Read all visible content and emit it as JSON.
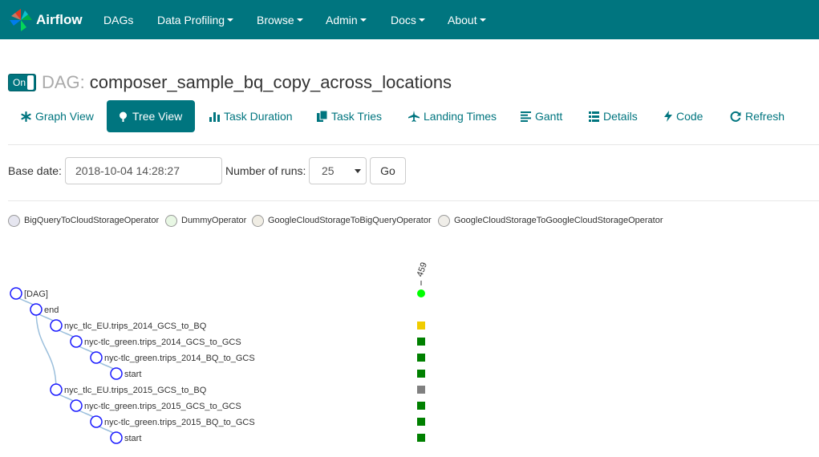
{
  "navbar": {
    "brand": "Airflow",
    "items": [
      {
        "label": "DAGs",
        "dropdown": false
      },
      {
        "label": "Data Profiling",
        "dropdown": true
      },
      {
        "label": "Browse",
        "dropdown": true
      },
      {
        "label": "Admin",
        "dropdown": true
      },
      {
        "label": "Docs",
        "dropdown": true
      },
      {
        "label": "About",
        "dropdown": true
      }
    ],
    "color": "#00757f"
  },
  "title": {
    "toggle_label": "On",
    "prefix": "DAG:",
    "dag_id": "composer_sample_bq_copy_across_locations"
  },
  "tabs": [
    {
      "label": "Graph View",
      "icon": "asterisk-icon",
      "active": false
    },
    {
      "label": "Tree View",
      "icon": "tree-icon",
      "active": true
    },
    {
      "label": "Task Duration",
      "icon": "bar-chart-icon",
      "active": false
    },
    {
      "label": "Task Tries",
      "icon": "duplicate-icon",
      "active": false
    },
    {
      "label": "Landing Times",
      "icon": "plane-icon",
      "active": false
    },
    {
      "label": "Gantt",
      "icon": "align-left-icon",
      "active": false
    },
    {
      "label": "Details",
      "icon": "list-icon",
      "active": false
    },
    {
      "label": "Code",
      "icon": "flash-icon",
      "active": false
    },
    {
      "label": "Refresh",
      "icon": "refresh-icon",
      "active": false
    }
  ],
  "form": {
    "base_date_label": "Base date:",
    "base_date_value": "2018-10-04 14:28:27",
    "num_runs_label": "Number of runs:",
    "num_runs_value": "25",
    "go_label": "Go"
  },
  "legend": [
    {
      "label": "BigQueryToCloudStorageOperator",
      "color": "#e6e6f0"
    },
    {
      "label": "DummyOperator",
      "color": "#e8f7e4"
    },
    {
      "label": "GoogleCloudStorageToBigQueryOperator",
      "color": "#f0ede4"
    },
    {
      "label": "GoogleCloudStorageToGoogleCloudStorageOperator",
      "color": "#f0eee9"
    }
  ],
  "tree": {
    "run_label": "459",
    "nodes": [
      {
        "label": "[DAG]",
        "depth": 0,
        "status": "success",
        "status_color": "#00ff00",
        "status_shape": "circle"
      },
      {
        "label": "end",
        "depth": 1,
        "status": "none",
        "status_color": "#ffffff",
        "status_shape": "square"
      },
      {
        "label": "nyc_tlc_EU.trips_2014_GCS_to_BQ",
        "depth": 2,
        "status": "upstream_failed",
        "status_color": "#f0cc00",
        "status_shape": "square"
      },
      {
        "label": "nyc-tlc_green.trips_2014_GCS_to_GCS",
        "depth": 3,
        "status": "success",
        "status_color": "#008000",
        "status_shape": "square"
      },
      {
        "label": "nyc-tlc_green.trips_2014_BQ_to_GCS",
        "depth": 4,
        "status": "success",
        "status_color": "#008000",
        "status_shape": "square"
      },
      {
        "label": "start",
        "depth": 5,
        "status": "success",
        "status_color": "#008000",
        "status_shape": "square"
      },
      {
        "label": "nyc_tlc_EU.trips_2015_GCS_to_BQ",
        "depth": 2,
        "status": "failed",
        "status_color": "#808080",
        "status_shape": "square"
      },
      {
        "label": "nyc-tlc_green.trips_2015_GCS_to_GCS",
        "depth": 3,
        "status": "success",
        "status_color": "#008000",
        "status_shape": "square"
      },
      {
        "label": "nyc-tlc_green.trips_2015_BQ_to_GCS",
        "depth": 4,
        "status": "success",
        "status_color": "#008000",
        "status_shape": "square"
      },
      {
        "label": "start",
        "depth": 5,
        "status": "success",
        "status_color": "#008000",
        "status_shape": "square"
      }
    ]
  }
}
